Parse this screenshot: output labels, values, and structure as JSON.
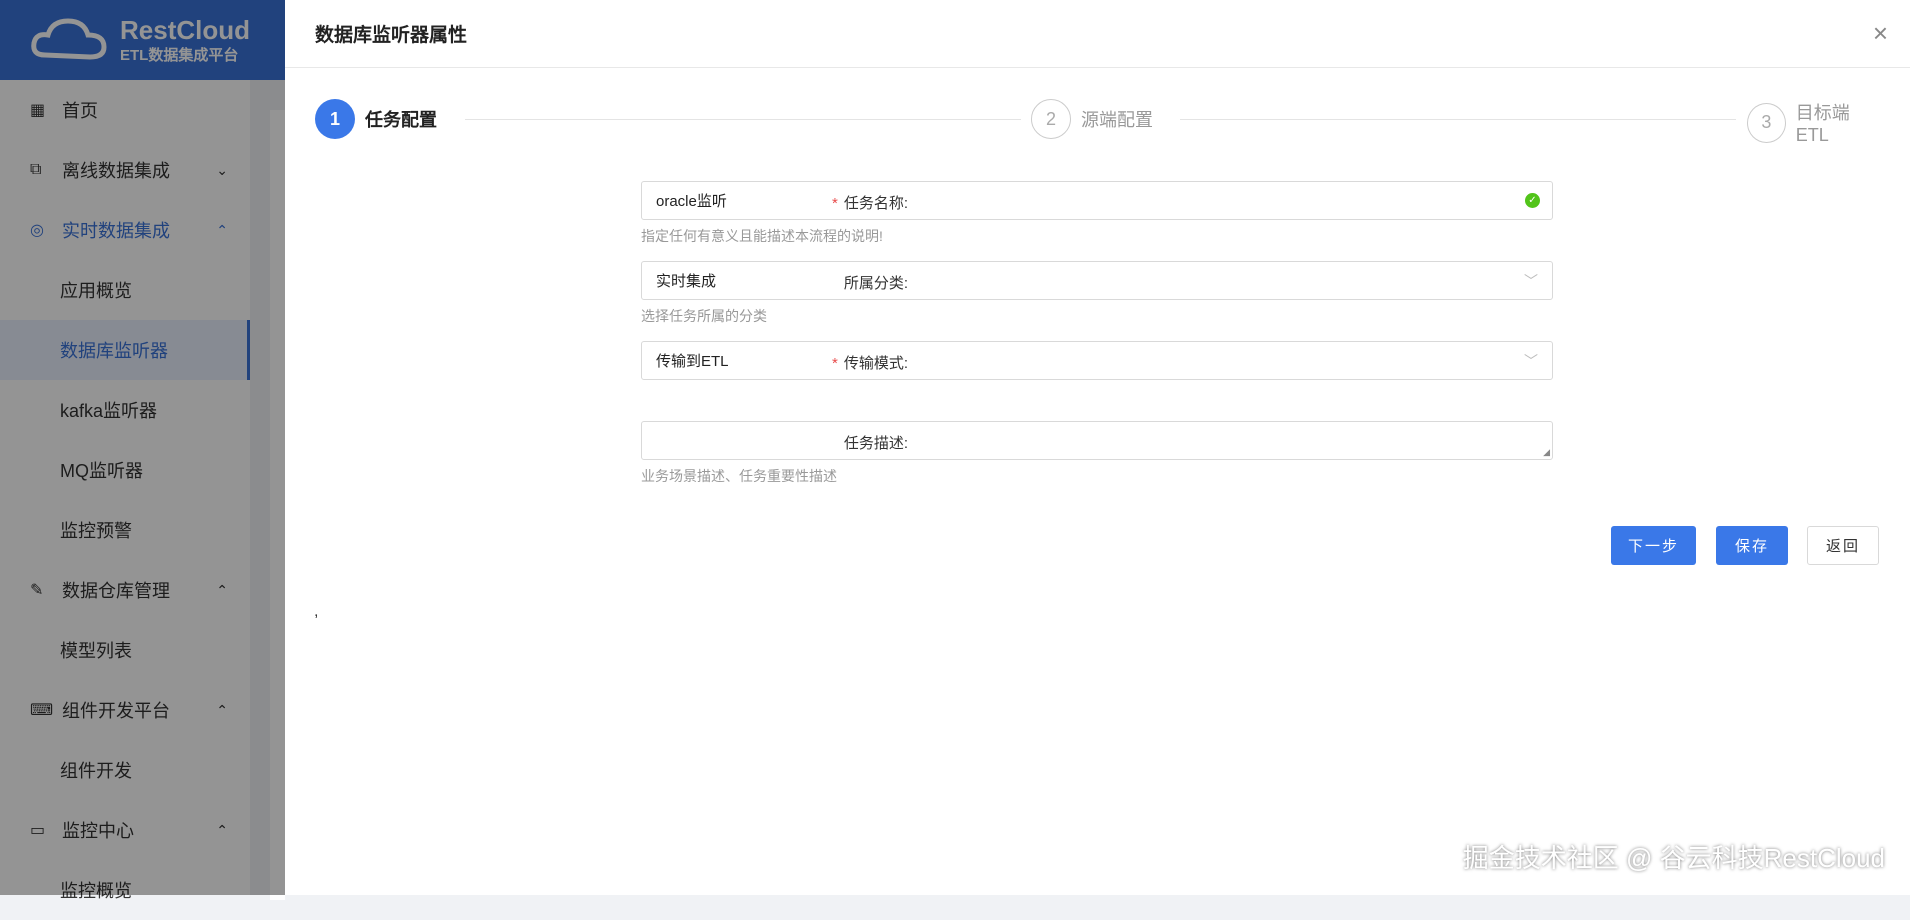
{
  "logo": {
    "name": "RestCloud",
    "subtitle": "ETL数据集成平台"
  },
  "sidebar": {
    "items": [
      {
        "label": "首页",
        "icon": "grid-icon"
      },
      {
        "label": "离线数据集成",
        "icon": "flow-icon",
        "chevron": "⌄"
      },
      {
        "label": "实时数据集成",
        "icon": "pulse-icon",
        "chevron": "⌃"
      },
      {
        "label": "应用概览"
      },
      {
        "label": "数据库监听器"
      },
      {
        "label": "kafka监听器"
      },
      {
        "label": "MQ监听器"
      },
      {
        "label": "监控预警"
      },
      {
        "label": "数据仓库管理",
        "icon": "edit-icon",
        "chevron": "⌃"
      },
      {
        "label": "模型列表"
      },
      {
        "label": "组件开发平台",
        "icon": "code-icon",
        "chevron": "⌃"
      },
      {
        "label": "组件开发"
      },
      {
        "label": "监控中心",
        "icon": "monitor-icon",
        "chevron": "⌃"
      },
      {
        "label": "监控概览"
      }
    ]
  },
  "drawer": {
    "title": "数据库监听器属性",
    "close": "×"
  },
  "steps": [
    {
      "num": "1",
      "label": "任务配置"
    },
    {
      "num": "2",
      "label": "源端配置"
    },
    {
      "num": "3",
      "label": "目标端ETL"
    }
  ],
  "form": {
    "name": {
      "label": "任务名称:",
      "value": "oracle监听",
      "hint": "指定任何有意义且能描述本流程的说明!",
      "status": "✓"
    },
    "category": {
      "label": "所属分类:",
      "value": "实时集成",
      "hint": "选择任务所属的分类"
    },
    "mode": {
      "label": "传输模式:",
      "value": "传输到ETL"
    },
    "desc": {
      "label": "任务描述:",
      "value": "",
      "hint": "业务场景描述、任务重要性描述"
    },
    "required_mark": "*"
  },
  "buttons": {
    "next": "下一步",
    "save": "保存",
    "back": "返回"
  },
  "stray": ",",
  "watermark": "掘金技术社区 @ 谷云科技RestCloud"
}
